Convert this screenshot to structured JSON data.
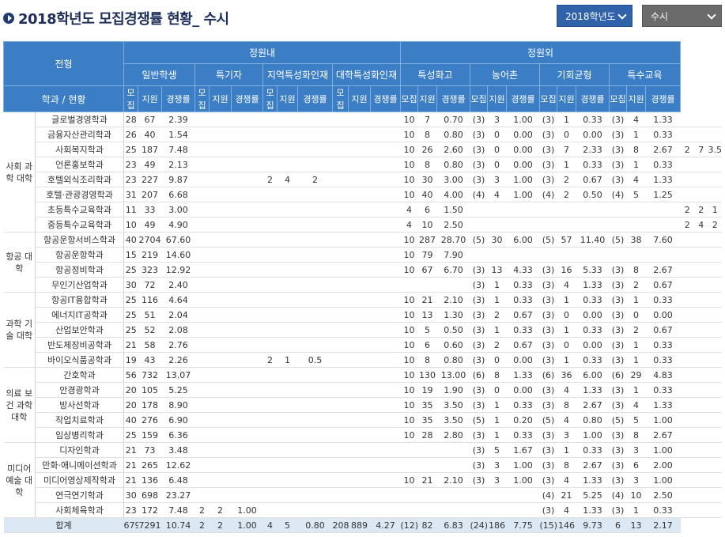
{
  "header": {
    "title": "2018학년도 모집경쟁률 현황_ 수시",
    "year_select": "2018학년도",
    "type_select": "수시"
  },
  "table": {
    "corner_top": "전형",
    "corner_bottom": "학과 / 현황",
    "group_inner": "정원내",
    "group_outer": "정원외",
    "categories": [
      "일반학생",
      "특기자",
      "지역특성화인재",
      "대학특성화인재",
      "특성화고",
      "농어촌",
      "기회균형",
      "특수교육"
    ],
    "sub_cols": [
      "모집",
      "지원",
      "경쟁률"
    ],
    "colleges": [
      {
        "name": "사회 과학 대학",
        "rowspan": 8
      },
      {
        "name": "항공 대학",
        "rowspan": 4
      },
      {
        "name": "과학 기술 대학",
        "rowspan": 5
      },
      {
        "name": "의료 보건 과학 대학",
        "rowspan": 5
      },
      {
        "name": "미디어 예술 대학",
        "rowspan": 5
      }
    ],
    "rows": [
      {
        "major": "글로벌경영학과",
        "cells": [
          "28",
          "67",
          "2.39",
          "",
          "",
          "",
          "",
          "",
          "",
          "",
          "",
          "",
          "10",
          "7",
          "0.70",
          "(3)",
          "3",
          "1.00",
          "(3)",
          "1",
          "0.33",
          "(3)",
          "4",
          "1.33",
          "",
          "",
          ""
        ]
      },
      {
        "major": "금융자산관리학과",
        "cells": [
          "26",
          "40",
          "1.54",
          "",
          "",
          "",
          "",
          "",
          "",
          "",
          "",
          "",
          "10",
          "8",
          "0.80",
          "(3)",
          "0",
          "0.00",
          "(3)",
          "0",
          "0.00",
          "(3)",
          "1",
          "0.33",
          "",
          "",
          ""
        ]
      },
      {
        "major": "사회복지학과",
        "cells": [
          "25",
          "187",
          "7.48",
          "",
          "",
          "",
          "",
          "",
          "",
          "",
          "",
          "",
          "10",
          "26",
          "2.60",
          "(3)",
          "0",
          "0.00",
          "(3)",
          "7",
          "2.33",
          "(3)",
          "8",
          "2.67",
          "2",
          "7",
          "3.50"
        ]
      },
      {
        "major": "언론홍보학과",
        "cells": [
          "23",
          "49",
          "2.13",
          "",
          "",
          "",
          "",
          "",
          "",
          "",
          "",
          "",
          "10",
          "8",
          "0.80",
          "(3)",
          "0",
          "0.00",
          "(3)",
          "1",
          "0.33",
          "(3)",
          "1",
          "0.33",
          "",
          "",
          ""
        ]
      },
      {
        "major": "호텔외식조리학과",
        "cells": [
          "23",
          "227",
          "9.87",
          "",
          "",
          "",
          "2",
          "4",
          "2",
          "",
          "",
          "",
          "10",
          "30",
          "3.00",
          "(3)",
          "3",
          "1.00",
          "(3)",
          "2",
          "0.67",
          "(3)",
          "4",
          "1.33",
          "",
          "",
          ""
        ]
      },
      {
        "major": "호텔·관광경영학과",
        "cells": [
          "31",
          "207",
          "6.68",
          "",
          "",
          "",
          "",
          "",
          "",
          "",
          "",
          "",
          "10",
          "40",
          "4.00",
          "(4)",
          "4",
          "1.00",
          "(4)",
          "2",
          "0.50",
          "(4)",
          "5",
          "1.25",
          "",
          "",
          ""
        ]
      },
      {
        "major": "초등특수교육학과",
        "cells": [
          "11",
          "33",
          "3.00",
          "",
          "",
          "",
          "",
          "",
          "",
          "",
          "",
          "",
          "4",
          "6",
          "1.50",
          "",
          "",
          "",
          "",
          "",
          "",
          "",
          "",
          "",
          "2",
          "2",
          "1"
        ]
      },
      {
        "major": "중등특수교육학과",
        "cells": [
          "10",
          "49",
          "4.90",
          "",
          "",
          "",
          "",
          "",
          "",
          "",
          "",
          "",
          "4",
          "10",
          "2.50",
          "",
          "",
          "",
          "",
          "",
          "",
          "",
          "",
          "",
          "2",
          "4",
          "2"
        ]
      },
      {
        "major": "항공운항서비스학과",
        "cells": [
          "40",
          "2704",
          "67.60",
          "",
          "",
          "",
          "",
          "",
          "",
          "",
          "",
          "",
          "10",
          "287",
          "28.70",
          "(5)",
          "30",
          "6.00",
          "(5)",
          "57",
          "11.40",
          "(5)",
          "38",
          "7.60",
          "",
          "",
          ""
        ]
      },
      {
        "major": "항공운항학과",
        "cells": [
          "15",
          "219",
          "14.60",
          "",
          "",
          "",
          "",
          "",
          "",
          "",
          "",
          "",
          "10",
          "79",
          "7.90",
          "",
          "",
          "",
          "",
          "",
          "",
          "",
          "",
          "",
          "",
          "",
          ""
        ]
      },
      {
        "major": "항공정비학과",
        "cells": [
          "25",
          "323",
          "12.92",
          "",
          "",
          "",
          "",
          "",
          "",
          "",
          "",
          "",
          "10",
          "67",
          "6.70",
          "(3)",
          "13",
          "4.33",
          "(3)",
          "16",
          "5.33",
          "(3)",
          "8",
          "2.67",
          "",
          "",
          ""
        ]
      },
      {
        "major": "무인기산업학과",
        "cells": [
          "30",
          "72",
          "2.40",
          "",
          "",
          "",
          "",
          "",
          "",
          "",
          "",
          "",
          "",
          "",
          "",
          "(3)",
          "1",
          "0.33",
          "(3)",
          "4",
          "1.33",
          "(3)",
          "2",
          "0.67",
          "",
          "",
          ""
        ]
      },
      {
        "major": "항공IT융합학과",
        "cells": [
          "25",
          "116",
          "4.64",
          "",
          "",
          "",
          "",
          "",
          "",
          "",
          "",
          "",
          "10",
          "21",
          "2.10",
          "(3)",
          "1",
          "0.33",
          "(3)",
          "1",
          "0.33",
          "(3)",
          "1",
          "0.33",
          "",
          "",
          ""
        ]
      },
      {
        "major": "에너지IT공학과",
        "cells": [
          "25",
          "51",
          "2.04",
          "",
          "",
          "",
          "",
          "",
          "",
          "",
          "",
          "",
          "10",
          "13",
          "1.30",
          "(3)",
          "2",
          "0.67",
          "(3)",
          "0",
          "0.00",
          "(3)",
          "0",
          "0.00",
          "",
          "",
          ""
        ]
      },
      {
        "major": "산업보안학과",
        "cells": [
          "25",
          "52",
          "2.08",
          "",
          "",
          "",
          "",
          "",
          "",
          "",
          "",
          "",
          "10",
          "5",
          "0.50",
          "(3)",
          "1",
          "0.33",
          "(3)",
          "1",
          "0.33",
          "(3)",
          "2",
          "0.67",
          "",
          "",
          ""
        ]
      },
      {
        "major": "반도체장비공학과",
        "cells": [
          "21",
          "58",
          "2.76",
          "",
          "",
          "",
          "",
          "",
          "",
          "",
          "",
          "",
          "10",
          "6",
          "0.60",
          "(3)",
          "2",
          "0.67",
          "(3)",
          "0",
          "0.00",
          "(3)",
          "1",
          "0.33",
          "",
          "",
          ""
        ]
      },
      {
        "major": "바이오식품공학과",
        "cells": [
          "19",
          "43",
          "2.26",
          "",
          "",
          "",
          "2",
          "1",
          "0.5",
          "",
          "",
          "",
          "10",
          "8",
          "0.80",
          "(3)",
          "0",
          "0.00",
          "(3)",
          "1",
          "0.33",
          "(3)",
          "1",
          "0.33",
          "",
          "",
          ""
        ]
      },
      {
        "major": "간호학과",
        "cells": [
          "56",
          "732",
          "13.07",
          "",
          "",
          "",
          "",
          "",
          "",
          "",
          "",
          "",
          "10",
          "130",
          "13.00",
          "(6)",
          "8",
          "1.33",
          "(6)",
          "36",
          "6.00",
          "(6)",
          "29",
          "4.83",
          "",
          "",
          ""
        ]
      },
      {
        "major": "안경광학과",
        "cells": [
          "20",
          "105",
          "5.25",
          "",
          "",
          "",
          "",
          "",
          "",
          "",
          "",
          "",
          "10",
          "19",
          "1.90",
          "(3)",
          "0",
          "0.00",
          "(3)",
          "4",
          "1.33",
          "(3)",
          "1",
          "0.33",
          "",
          "",
          ""
        ]
      },
      {
        "major": "방사선학과",
        "cells": [
          "20",
          "178",
          "8.90",
          "",
          "",
          "",
          "",
          "",
          "",
          "",
          "",
          "",
          "10",
          "35",
          "3.50",
          "(3)",
          "1",
          "0.33",
          "(3)",
          "8",
          "2.67",
          "(3)",
          "4",
          "1.33",
          "",
          "",
          ""
        ]
      },
      {
        "major": "작업치료학과",
        "cells": [
          "40",
          "276",
          "6.90",
          "",
          "",
          "",
          "",
          "",
          "",
          "",
          "",
          "",
          "10",
          "35",
          "3.50",
          "(5)",
          "1",
          "0.20",
          "(5)",
          "4",
          "0.80",
          "(5)",
          "5",
          "1.00",
          "",
          "",
          ""
        ]
      },
      {
        "major": "임상병리학과",
        "cells": [
          "25",
          "159",
          "6.36",
          "",
          "",
          "",
          "",
          "",
          "",
          "",
          "",
          "",
          "10",
          "28",
          "2.80",
          "(3)",
          "1",
          "0.33",
          "(3)",
          "3",
          "1.00",
          "(3)",
          "8",
          "2.67",
          "",
          "",
          ""
        ]
      },
      {
        "major": "디자인학과",
        "cells": [
          "21",
          "73",
          "3.48",
          "",
          "",
          "",
          "",
          "",
          "",
          "",
          "",
          "",
          "",
          "",
          "",
          "(3)",
          "5",
          "1.67",
          "(3)",
          "1",
          "0.33",
          "(3)",
          "3",
          "1.00",
          "",
          "",
          ""
        ]
      },
      {
        "major": "만화·애니메이션학과",
        "cells": [
          "21",
          "265",
          "12.62",
          "",
          "",
          "",
          "",
          "",
          "",
          "",
          "",
          "",
          "",
          "",
          "",
          "(3)",
          "3",
          "1.00",
          "(3)",
          "8",
          "2.67",
          "(3)",
          "6",
          "2.00",
          "",
          "",
          ""
        ]
      },
      {
        "major": "미디어영상제작학과",
        "cells": [
          "21",
          "136",
          "6.48",
          "",
          "",
          "",
          "",
          "",
          "",
          "",
          "",
          "",
          "10",
          "21",
          "2.10",
          "(3)",
          "3",
          "1.00",
          "(3)",
          "4",
          "1.33",
          "(3)",
          "3",
          "1.00",
          "",
          "",
          ""
        ]
      },
      {
        "major": "연극연기학과",
        "cells": [
          "30",
          "698",
          "23.27",
          "",
          "",
          "",
          "",
          "",
          "",
          "",
          "",
          "",
          "",
          "",
          "",
          "",
          "",
          "",
          "(4)",
          "21",
          "5.25",
          "(4)",
          "10",
          "2.50",
          "",
          "",
          ""
        ]
      },
      {
        "major": "사회체육학과",
        "cells": [
          "23",
          "172",
          "7.48",
          "2",
          "2",
          "1.00",
          "",
          "",
          "",
          "",
          "",
          "",
          "",
          "",
          "",
          "",
          "",
          "",
          "(3)",
          "4",
          "1.33",
          "(3)",
          "1",
          "0.33",
          "",
          "",
          ""
        ]
      }
    ],
    "total": {
      "label": "합계",
      "cells": [
        "679",
        "7291",
        "10.74",
        "2",
        "2",
        "1.00",
        "4",
        "5",
        "0.80",
        "208",
        "889",
        "4.27",
        "(12)",
        "82",
        "6.83",
        "(24)",
        "186",
        "7.75",
        "(15)",
        "146",
        "9.73",
        "6",
        "13",
        "2.17"
      ]
    }
  }
}
